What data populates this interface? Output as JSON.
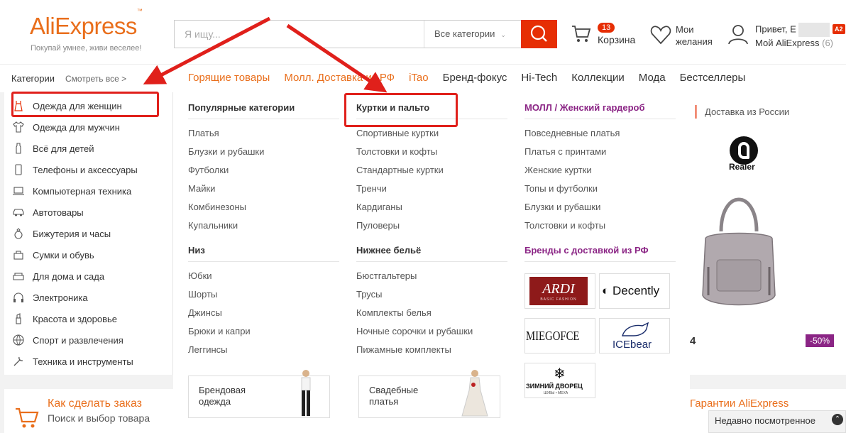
{
  "header": {
    "logo": "AliExpress",
    "logo_mark": "™",
    "tagline": "Покупай умнее, живи веселее!",
    "search_placeholder": "Я ищу...",
    "search_category": "Все категории",
    "cart_count": "13",
    "cart_label": "Корзина",
    "wishlist_line1": "Мои",
    "wishlist_line2": "желания",
    "greeting": "Привет, E",
    "my_ali": "Мой AliExpress",
    "my_ali_count": "(6)",
    "badge": "A2"
  },
  "nav": {
    "categories": "Категории",
    "see_all": "Смотреть все >",
    "links": [
      {
        "label": "Горящие товары",
        "color": "orange"
      },
      {
        "label": "Молл. Доставка из РФ",
        "color": "orange"
      },
      {
        "label": "iTao",
        "color": "orange"
      },
      {
        "label": "Бренд-фокус",
        "color": "dark"
      },
      {
        "label": "Hi-Tech",
        "color": "dark"
      },
      {
        "label": "Коллекции",
        "color": "dark"
      },
      {
        "label": "Мода",
        "color": "dark"
      },
      {
        "label": "Бестселлеры",
        "color": "dark"
      }
    ]
  },
  "sidebar": {
    "items": [
      {
        "label": "Одежда для женщин",
        "icon": "dress-icon"
      },
      {
        "label": "Одежда для мужчин",
        "icon": "shirt-icon"
      },
      {
        "label": "Всё для детей",
        "icon": "baby-bottle-icon"
      },
      {
        "label": "Телефоны и аксессуары",
        "icon": "phone-icon"
      },
      {
        "label": "Компьютерная техника",
        "icon": "laptop-icon"
      },
      {
        "label": "Автотовары",
        "icon": "car-icon"
      },
      {
        "label": "Бижутерия и часы",
        "icon": "ring-icon"
      },
      {
        "label": "Сумки и обувь",
        "icon": "bag-icon"
      },
      {
        "label": "Для дома и сада",
        "icon": "sofa-icon"
      },
      {
        "label": "Электроника",
        "icon": "headphones-icon"
      },
      {
        "label": "Красота и здоровье",
        "icon": "lipstick-icon"
      },
      {
        "label": "Спорт и развлечения",
        "icon": "ball-icon"
      },
      {
        "label": "Техника и инструменты",
        "icon": "tools-icon"
      }
    ]
  },
  "mega": {
    "col1": {
      "title": "Популярные категории",
      "links": [
        "Платья",
        "Блузки и рубашки",
        "Футболки",
        "Майки",
        "Комбинезоны",
        "Купальники"
      ],
      "title2": "Низ",
      "links2": [
        "Юбки",
        "Шорты",
        "Джинсы",
        "Брюки и капри",
        "Леггинсы"
      ],
      "promo": "Брендовая одежда"
    },
    "col2": {
      "title": "Куртки и пальто",
      "links": [
        "Спортивные куртки",
        "Толстовки и кофты",
        "Стандартные куртки",
        "Тренчи",
        "Кардиганы",
        "Пуловеры"
      ],
      "title2": "Нижнее бельё",
      "links2": [
        "Бюстгальтеры",
        "Трусы",
        "Комплекты белья",
        "Ночные сорочки и рубашки",
        "Пижамные комплекты"
      ],
      "promo": "Свадебные платья"
    },
    "col3": {
      "title": "МОЛЛ / Женский гардероб",
      "links": [
        "Повседневные платья",
        "Платья с принтами",
        "Женские куртки",
        "Топы и футболки",
        "Блузки и рубашки",
        "Толстовки и кофты"
      ],
      "title2": "Бренды с доставкой из РФ",
      "brands": [
        "ARDI",
        "Decently",
        "MIEGOFCE",
        "ICEbear",
        "ЗИМНИЙ ДВОРЕЦ"
      ],
      "brand_sub": [
        "BASIC FASHION",
        "ШУБЫ • МЕХА"
      ]
    }
  },
  "right": {
    "delivery": "Доставка из России",
    "brand": "Realer",
    "discount": "-50%",
    "price_fragment": "4"
  },
  "bottom": {
    "howto_title": "Как сделать заказ",
    "howto_sub": "Поиск и выбор товара",
    "guarantee": "Гарантии AliExpress",
    "recent": "Недавно посмотренное"
  },
  "colors": {
    "accent_orange": "#e96e1b",
    "accent_red": "#e62e04",
    "mall_purple": "#8b2585",
    "annotation_red": "#e0201b"
  }
}
